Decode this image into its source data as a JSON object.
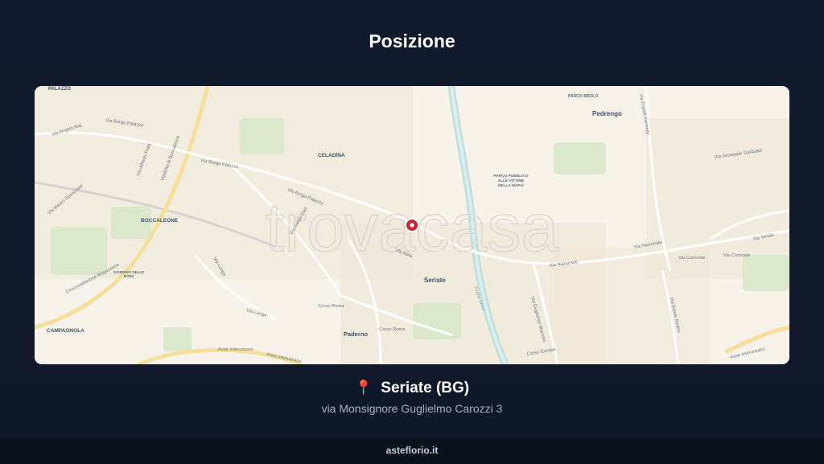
{
  "page": {
    "title": "Posizione"
  },
  "map": {
    "watermark": "trovacasa",
    "labels": {
      "palazzo": "PALAZZO",
      "parco_brolo": "PARCO BROLO",
      "pedrengo": "Pedrengo",
      "celadina": "CELADINA",
      "parco_pubblico": [
        "PARCO PUBBLICO",
        "ALLE VITTIME",
        "DELLA MAFIA"
      ],
      "boccaleone": "BOCCALEONE",
      "seriate": "Seriate",
      "campagnola": "CAMPAGNOLA",
      "paderno": "Paderno",
      "giardino": [
        "GIARDINO DELLE",
        "ROSE"
      ],
      "via_angelo_maj": "Via Angelo Maj",
      "via_borgo_palazzo_1": "Via Borgo Palazzo",
      "via_borgo_palazzo_2": "Via Borgo Palazzo",
      "via_borgo_palazzo_3": "Via Borgo Palazzo",
      "viadotto": "Viadotto di Boccaleone",
      "via_alfredo_piatti": "Via Alfredo Piatti",
      "via_mauro_gavazzeni": "Via Mauro Gavazzeni",
      "circonvallazione": "Circonvallazione Mugazzone",
      "via_guido_galli": "Via Guido Galli",
      "via_italia": "Via Italia",
      "via_nazionale_1": "Via Nazionale",
      "via_nazionale_2": "Via Nazionale",
      "via_comonte_1": "Via Comonte",
      "via_comonte_2": "Via Comonte",
      "via_tonale": "Via Tonale",
      "via_giuseppe_garibaldi": "Via Giuseppe Garibaldi",
      "via_kennedy": "Via Fratelli Kennedy",
      "via_lunga_1": "Via Lunga",
      "via_lunga_2": "Via Lunga",
      "corso_roma_1": "Corso Roma",
      "corso_roma_2": "Corso Roma",
      "asse_interurbano_1": "Asse Interurbano",
      "asse_interurbano_2": "Asse Interurbano",
      "asse_interurbano_3": "Asse Interurbano",
      "via_guglielmo_marconi": "Via Guglielmo Marconi",
      "via_basse_alzano": "Via Basse Alzano",
      "corso_europa": "Corso Europa",
      "fiume_serio": "Fiume Serio"
    },
    "pin_color": "#c4263a"
  },
  "location": {
    "pin_icon": "📍",
    "city": "Seriate (BG)",
    "address": "via Monsignore Guglielmo Carozzi 3"
  },
  "footer": {
    "brand": "asteflorio.it"
  }
}
